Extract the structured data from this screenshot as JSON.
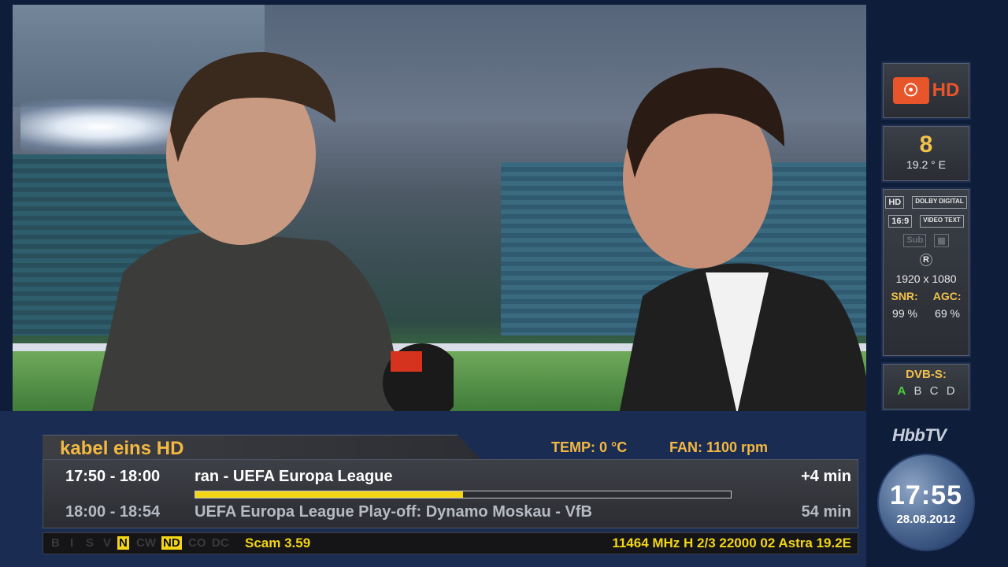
{
  "channel": {
    "logo_text": "HD",
    "number": "8",
    "satellite": "19.2 ° E",
    "name": "kabel eins HD"
  },
  "info_badges": [
    "HD",
    "DOLBY DIGITAL",
    "16:9",
    "VIDEO TEXT",
    "Sub",
    "R"
  ],
  "resolution": "1920 x 1080",
  "signal": {
    "snr_label": "SNR:",
    "agc_label": "AGC:",
    "snr_value": "99 %",
    "agc_value": "69 %"
  },
  "dvb": {
    "title": "DVB-S:",
    "letters": [
      "A",
      "B",
      "C",
      "D"
    ],
    "active": "A"
  },
  "hbbtv": "HbbTV",
  "clock": {
    "time": "17:55",
    "date": "28.08.2012"
  },
  "status": {
    "temp": "TEMP: 0 °C",
    "fan": "FAN: 1100 rpm"
  },
  "epg": {
    "now": {
      "time": "17:50 - 18:00",
      "title": "ran - UEFA Europa League",
      "remaining": "+4 min",
      "progress": 0.5
    },
    "next": {
      "time": "18:00 - 18:54",
      "title": "UEFA Europa League Play-off: Dynamo Moskau - VfB",
      "remaining": "54 min"
    }
  },
  "statusbar": {
    "flags": [
      "B",
      "I",
      "S",
      "V",
      "N",
      "CW",
      "ND",
      "CO",
      "DC"
    ],
    "active_flags": [
      "N",
      "ND"
    ],
    "scam": "Scam 3.59",
    "tuner": "11464 MHz H 2/3 22000  02 Astra 19.2E"
  },
  "colors": {
    "accent": "#f3b842",
    "progress": "#f3d516",
    "panel_bg": "#1a2c52"
  }
}
